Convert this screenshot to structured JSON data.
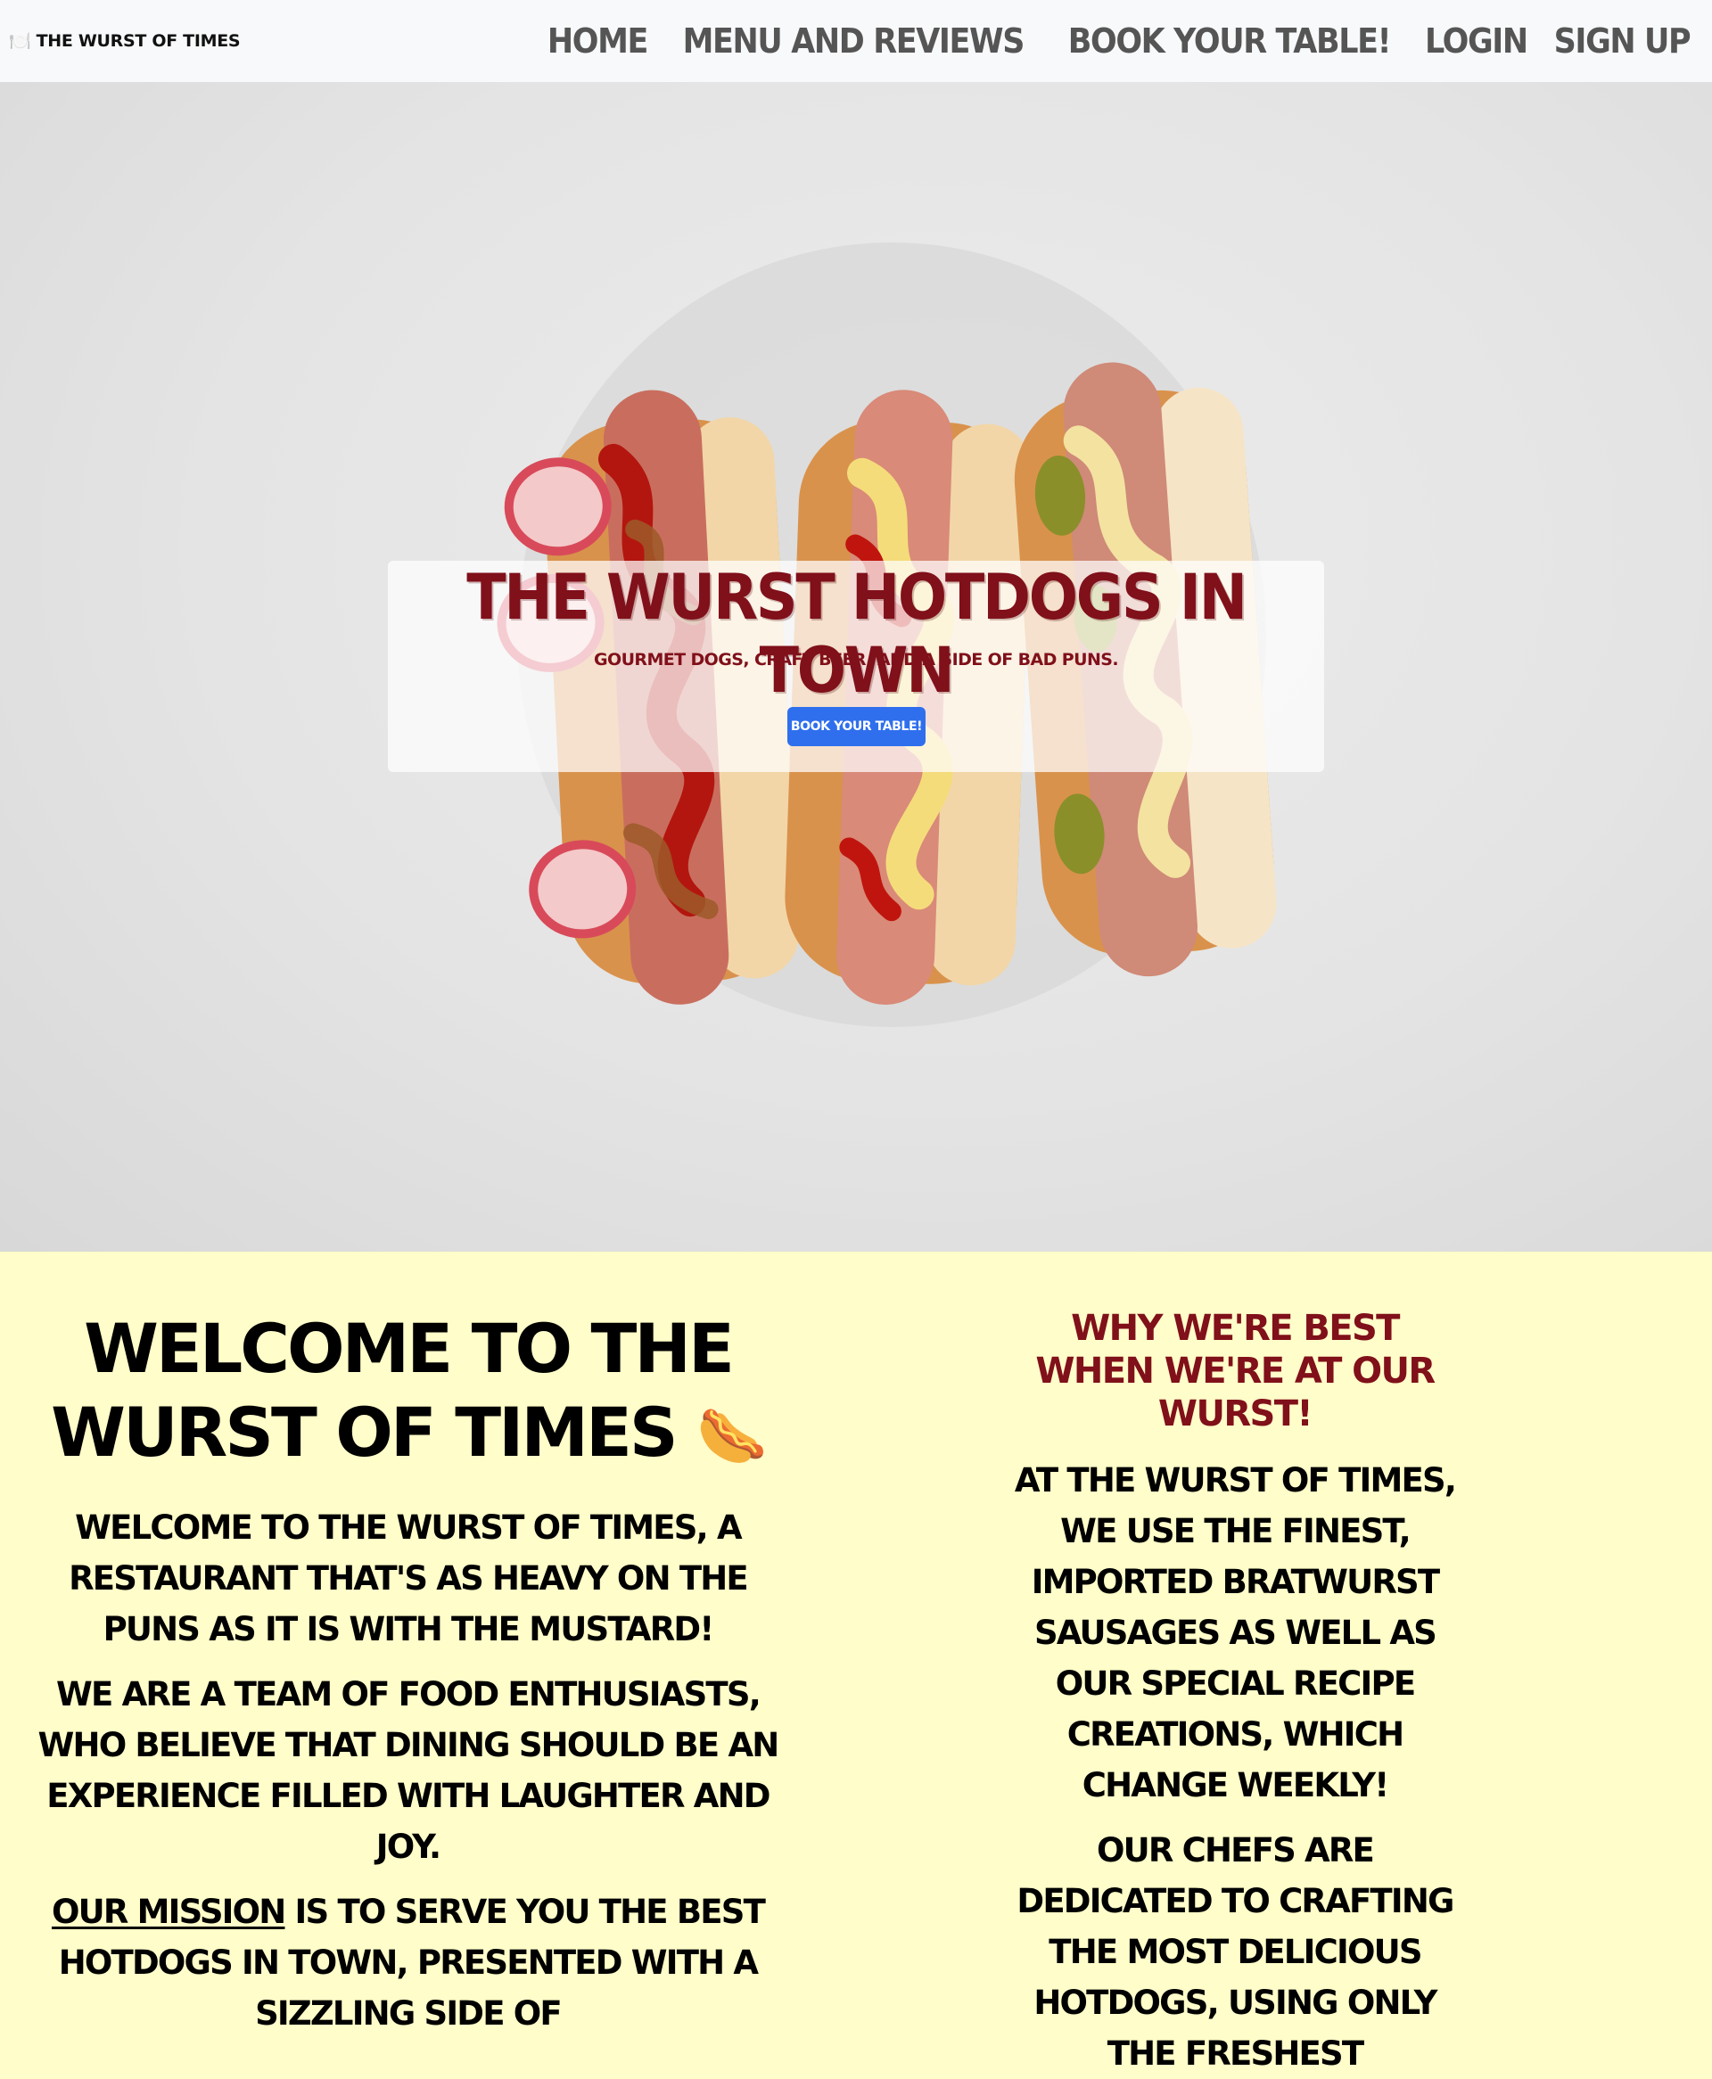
{
  "navbar": {
    "brand_icon": "🍽️",
    "brand": "The Wurst of Times",
    "links": [
      {
        "label": "Home"
      },
      {
        "label": "Menu and Reviews"
      },
      {
        "label": "Book your table!"
      },
      {
        "label": "Login"
      },
      {
        "label": "Sign Up"
      }
    ]
  },
  "hero": {
    "title": "The Wurst Hotdogs in Town",
    "subtitle": "Gourmet dogs, craft beer, and a side of bad puns.",
    "button": "Book your table!"
  },
  "welcome": {
    "title": "Welcome to the Wurst of Times",
    "title_emoji": "🌭",
    "p1": "Welcome to the Wurst of Times, a restaurant that's as heavy on the puns as it is with the mustard!",
    "p2": "We are a team of food enthusiasts, who believe that dining should be an experience filled with laughter and joy.",
    "p3_link": "Our mission",
    "p3_rest": " is to serve you the best hotdogs in town, presented with a sizzling side of"
  },
  "why": {
    "title": "Why we're best when we're at our wurst!",
    "p1": "At the Wurst of Times, we use the finest, imported bratwurst sausages as well as our special recipe creations, which change weekly!",
    "p2": "Our chefs are dedicated to crafting the most delicious hotdogs, using only the freshest"
  },
  "colors": {
    "navbar_bg": "#f8f9fa",
    "nav_link": "#555555",
    "accent_red": "#80101a",
    "button_blue": "#2f6fed",
    "section_bg": "#fffdc9"
  }
}
